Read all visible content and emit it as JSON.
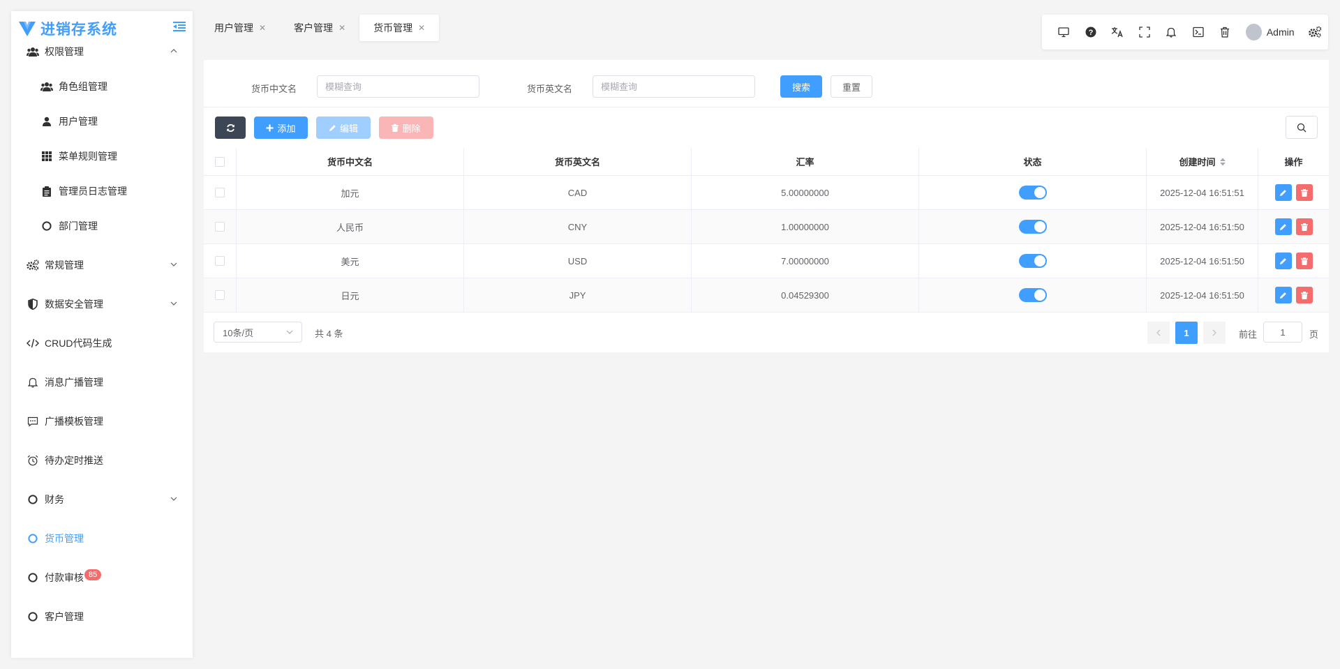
{
  "app": {
    "title": "进销存系统"
  },
  "sidebar": {
    "items": [
      {
        "label": "权限管理"
      },
      {
        "label": "角色组管理"
      },
      {
        "label": "用户管理"
      },
      {
        "label": "菜单规则管理"
      },
      {
        "label": "管理员日志管理"
      },
      {
        "label": "部门管理"
      },
      {
        "label": "常规管理"
      },
      {
        "label": "数据安全管理"
      },
      {
        "label": "CRUD代码生成"
      },
      {
        "label": "消息广播管理"
      },
      {
        "label": "广播模板管理"
      },
      {
        "label": "待办定时推送"
      },
      {
        "label": "财务"
      },
      {
        "label": "货币管理"
      },
      {
        "label": "付款审核",
        "badge": "85"
      },
      {
        "label": "客户管理"
      }
    ]
  },
  "tabs": [
    {
      "label": "用户管理"
    },
    {
      "label": "客户管理"
    },
    {
      "label": "货币管理",
      "active": true
    }
  ],
  "header": {
    "user_name": "Admin"
  },
  "search": {
    "cn_label": "货币中文名",
    "cn_placeholder": "模糊查询",
    "en_label": "货币英文名",
    "en_placeholder": "模糊查询",
    "search_label": "搜索",
    "reset_label": "重置"
  },
  "actions": {
    "add_label": "添加",
    "edit_label": "编辑",
    "delete_label": "删除"
  },
  "table": {
    "columns": [
      "货币中文名",
      "货币英文名",
      "汇率",
      "状态",
      "创建时间",
      "操作"
    ],
    "rows": [
      {
        "name_cn": "加元",
        "name_en": "CAD",
        "rate": "5.00000000",
        "status": true,
        "created": "2025-12-04 16:51:51"
      },
      {
        "name_cn": "人民币",
        "name_en": "CNY",
        "rate": "1.00000000",
        "status": true,
        "created": "2025-12-04 16:51:50"
      },
      {
        "name_cn": "美元",
        "name_en": "USD",
        "rate": "7.00000000",
        "status": true,
        "created": "2025-12-04 16:51:50"
      },
      {
        "name_cn": "日元",
        "name_en": "JPY",
        "rate": "0.04529300",
        "status": true,
        "created": "2025-12-04 16:51:50"
      }
    ]
  },
  "pagination": {
    "page_size": "10条/页",
    "total": "共 4 条",
    "current": "1",
    "goto_prefix": "前往",
    "goto_value": "1",
    "goto_suffix": "页"
  },
  "colors": {
    "primary": "#409eff",
    "danger": "#f56c6c",
    "dark": "#3d4654"
  }
}
